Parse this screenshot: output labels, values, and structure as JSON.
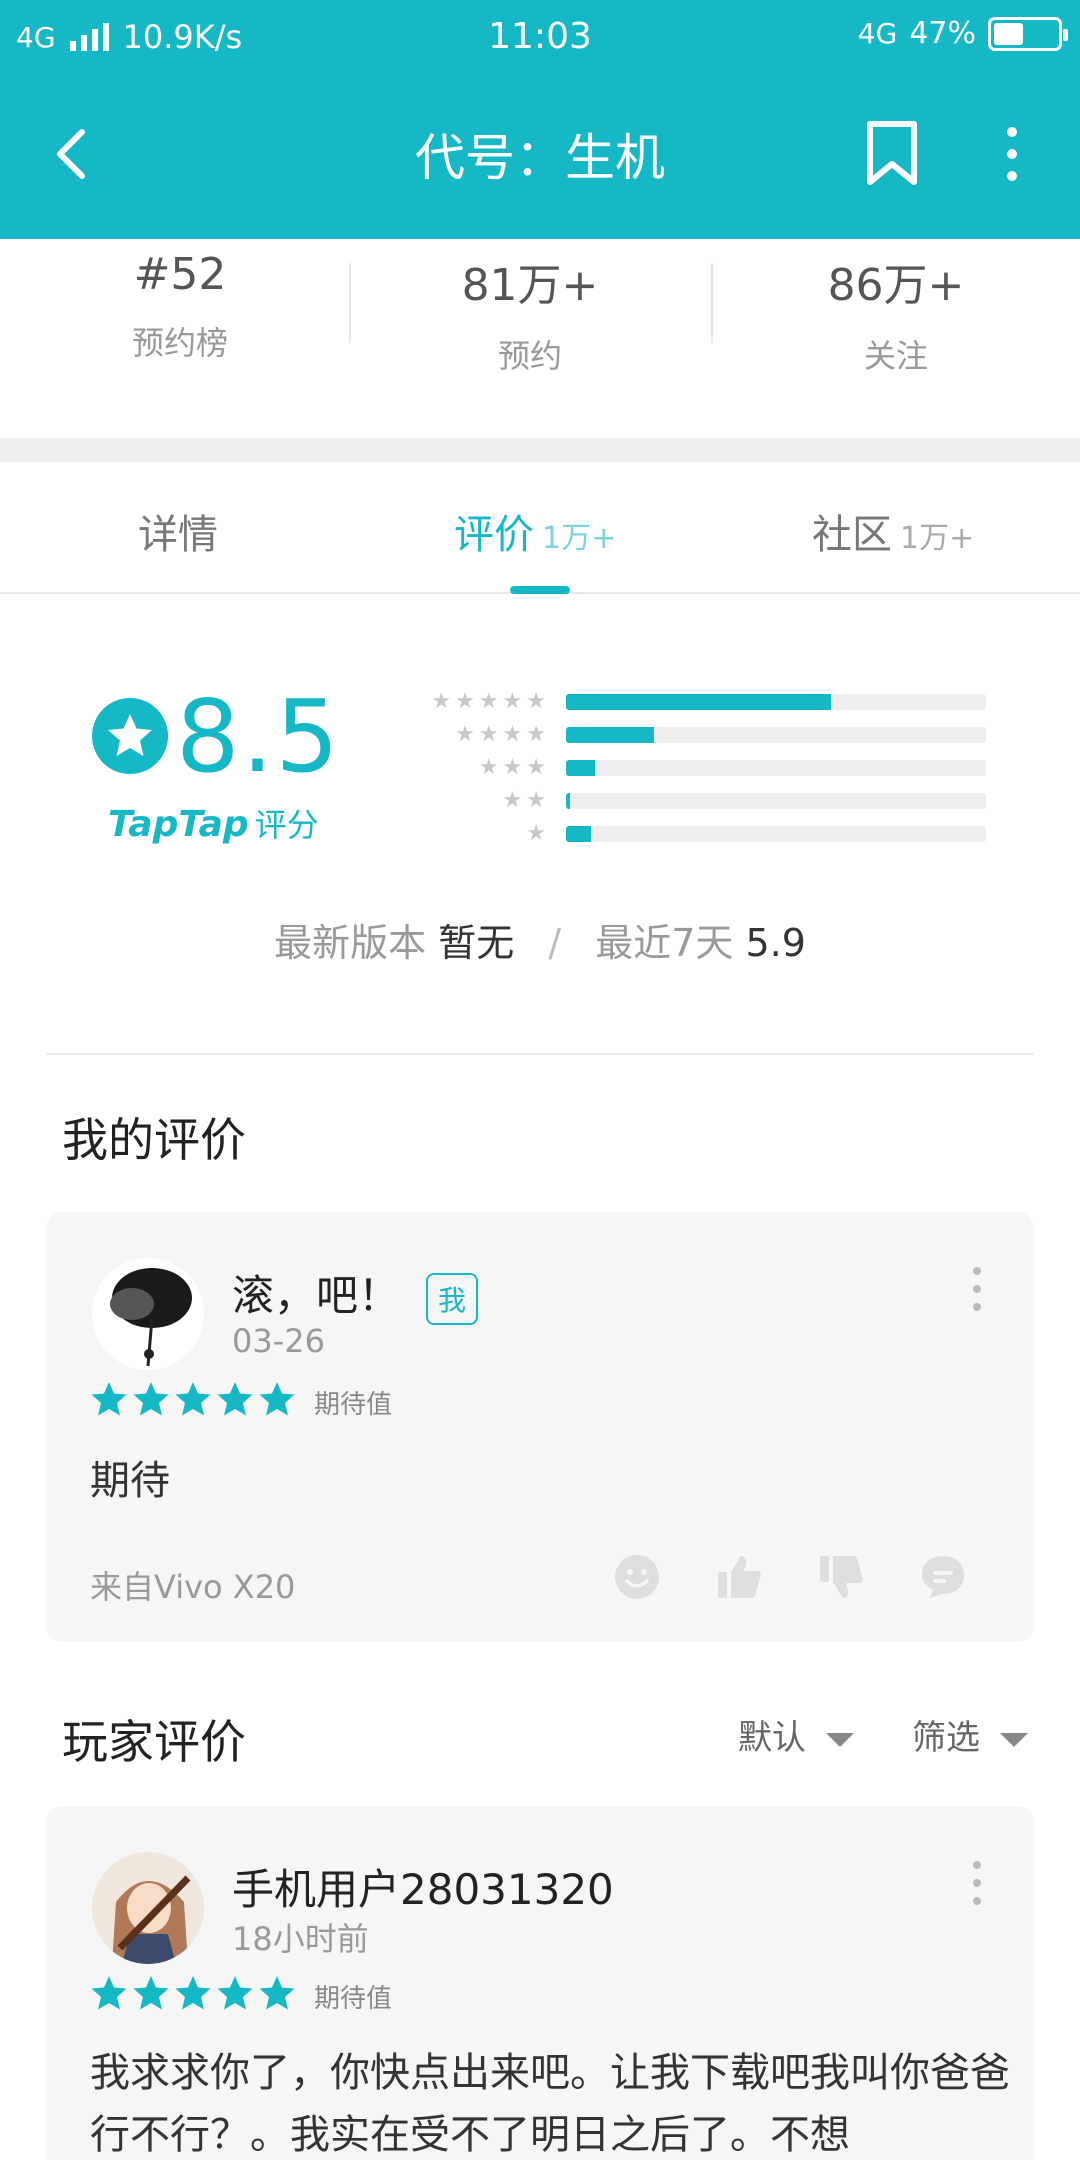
{
  "status_bar": {
    "network": "4G",
    "speed": "10.9K/s",
    "time": "11:03",
    "net_right": "4G",
    "battery": "47%",
    "battery_level": 0.47
  },
  "app_bar": {
    "title": "代号：生机",
    "back_icon": "back-arrow-icon",
    "bookmark_icon": "bookmark-icon",
    "more_icon": "more-vertical-icon"
  },
  "stats": [
    {
      "value": "#52",
      "label": "预约榜"
    },
    {
      "value": "81万+",
      "label": "预约"
    },
    {
      "value": "86万+",
      "label": "关注"
    }
  ],
  "tabs": [
    {
      "label": "详情",
      "count": ""
    },
    {
      "label": "评价",
      "count": "1万+"
    },
    {
      "label": "社区",
      "count": "1万+"
    }
  ],
  "active_tab": 1,
  "rating": {
    "score": "8.5",
    "brand": "TapTap",
    "brand_suffix": "评分",
    "distribution": [
      {
        "stars": 5,
        "fraction": 0.63
      },
      {
        "stars": 4,
        "fraction": 0.21
      },
      {
        "stars": 3,
        "fraction": 0.07
      },
      {
        "stars": 2,
        "fraction": 0.01
      },
      {
        "stars": 1,
        "fraction": 0.06
      }
    ],
    "latest_label": "最新版本",
    "latest_value": "暂无",
    "slash": "/",
    "recent_label": "最近7天",
    "recent_value": "5.9"
  },
  "my_review": {
    "section_title": "我的评价",
    "username": "滚，吧！",
    "badge": "我",
    "date": "03-26",
    "stars": 5,
    "star_label": "期待值",
    "text": "期待",
    "device": "来自Vivo X20",
    "actions": [
      "emoji-icon",
      "thumbs-up-icon",
      "thumbs-down-icon",
      "comment-icon"
    ]
  },
  "player_reviews": {
    "section_title": "玩家评价",
    "sort_label": "默认",
    "filter_label": "筛选",
    "items": [
      {
        "username": "手机用户28031320",
        "date": "18小时前",
        "stars": 5,
        "star_label": "期待值",
        "text": "我求求你了，你快点出来吧。让我下载吧我叫你爸爸行不行？。我实在受不了明日之后了。不想"
      }
    ]
  },
  "colors": {
    "accent": "#16b8c6",
    "card_bg": "#f6f6f6",
    "band": "#eeeeee"
  }
}
